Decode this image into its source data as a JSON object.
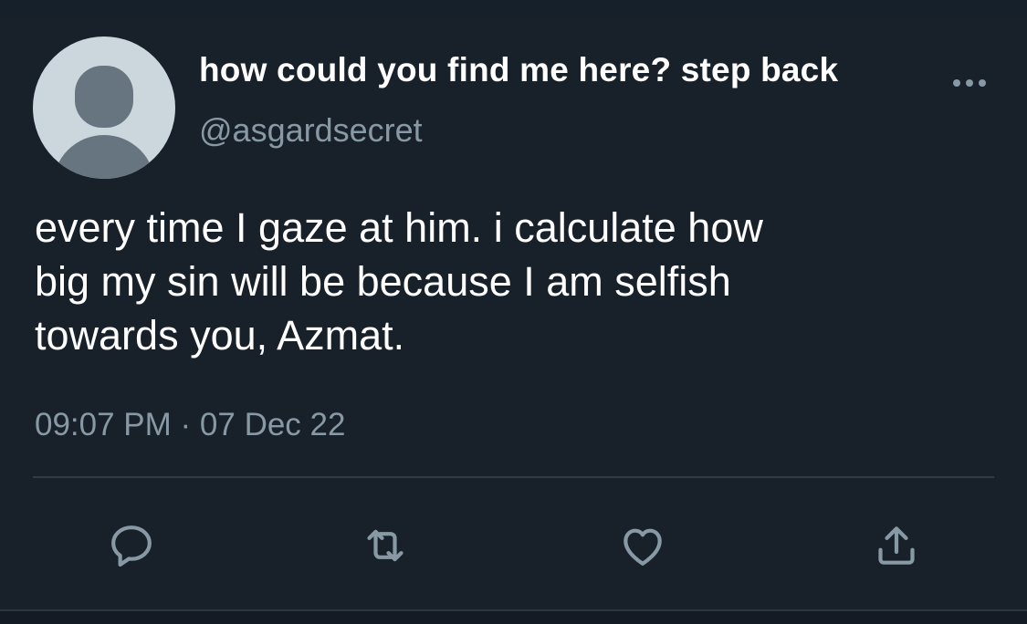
{
  "tweet": {
    "display_name": "how could you find me here? step back",
    "handle": "@asgardsecret",
    "text_lines": [
      "every time I gaze at him. i calculate how",
      "big my sin will be because I am selfish",
      "towards you, Azmat."
    ],
    "timestamp": "09:07 PM · 07 Dec 22"
  },
  "icons": {
    "avatar": "default-avatar",
    "more": "more-options-icon",
    "reply": "reply-icon",
    "retweet": "retweet-icon",
    "like": "like-heart-icon",
    "share": "share-icon"
  },
  "colors": {
    "background": "#18202a",
    "text": "#ffffff",
    "secondary_text": "#8899a6",
    "icon": "#8899a6",
    "divider": "#2f3b47"
  }
}
